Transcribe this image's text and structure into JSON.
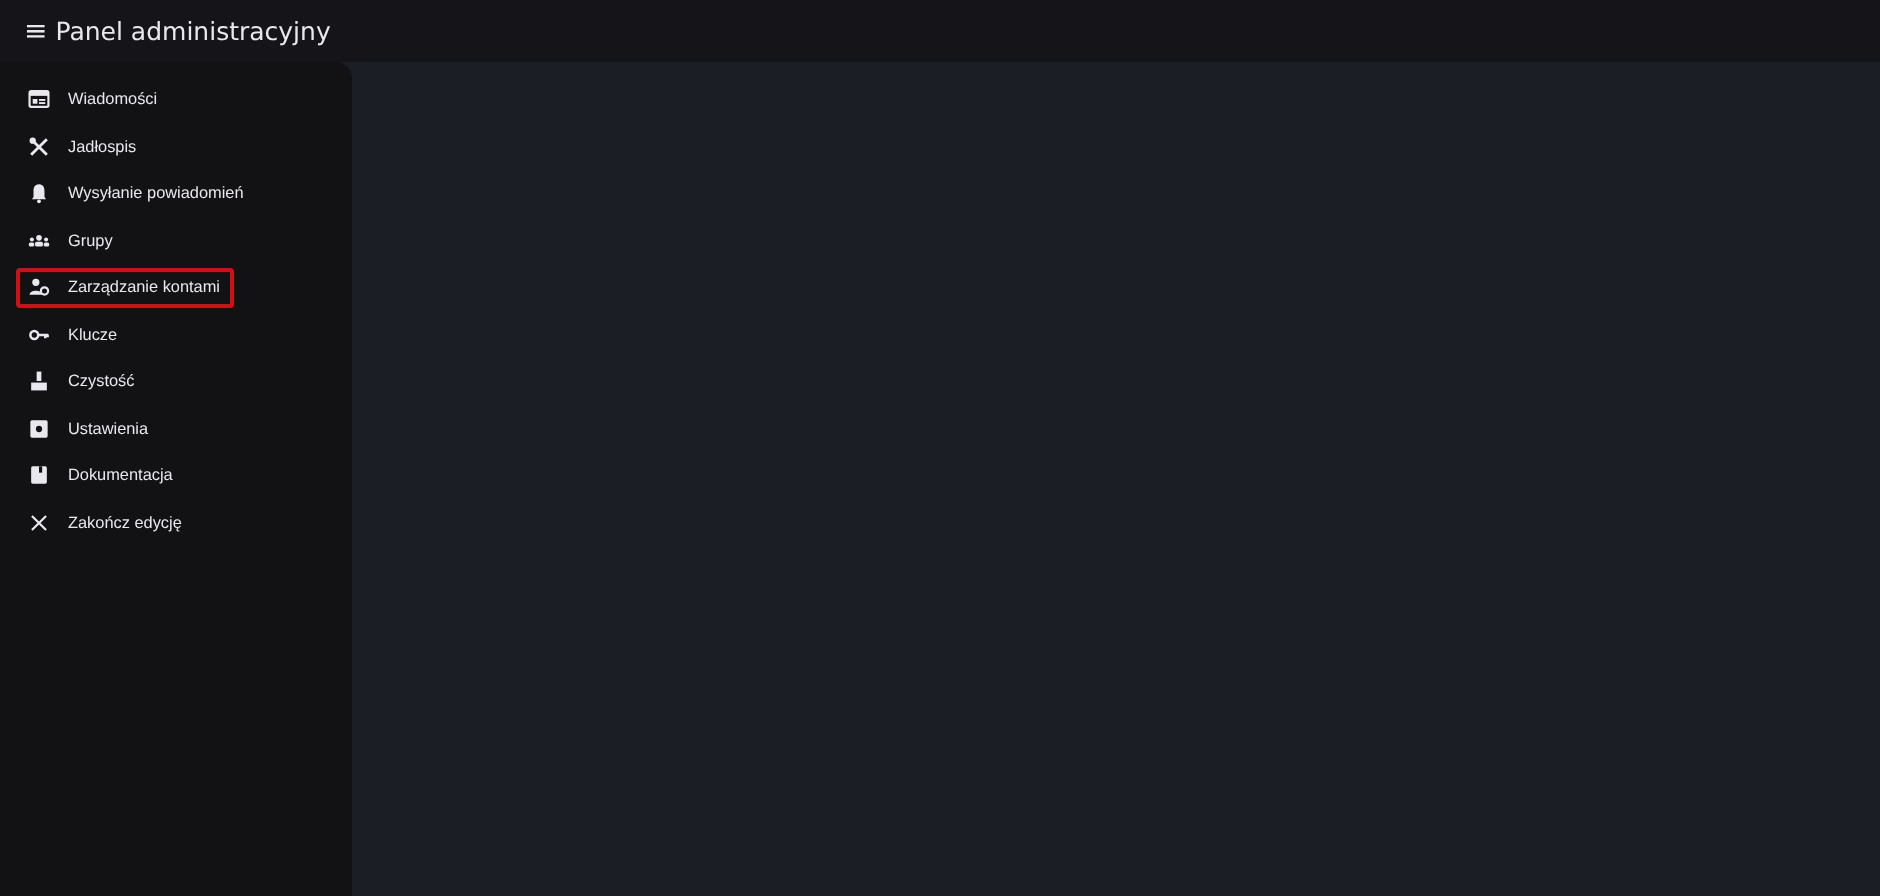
{
  "app_bar": {
    "menu_icon": "≡",
    "title": "Panel administracyjny"
  },
  "sidebar": {
    "items": [
      {
        "label": "Wiadomości",
        "highlighted": false
      },
      {
        "label": "Jadłospis",
        "highlighted": false
      },
      {
        "label": "Wysyłanie powiadomień",
        "highlighted": false
      },
      {
        "label": "Grupy",
        "highlighted": false
      },
      {
        "label": "Zarządzanie kontami",
        "highlighted": true
      },
      {
        "label": "Klucze",
        "highlighted": false
      },
      {
        "label": "Czystość",
        "highlighted": false
      },
      {
        "label": "Ustawienia",
        "highlighted": false
      },
      {
        "label": "Dokumentacja",
        "highlighted": false
      },
      {
        "label": "Zakończ edycję",
        "highlighted": false
      }
    ]
  }
}
